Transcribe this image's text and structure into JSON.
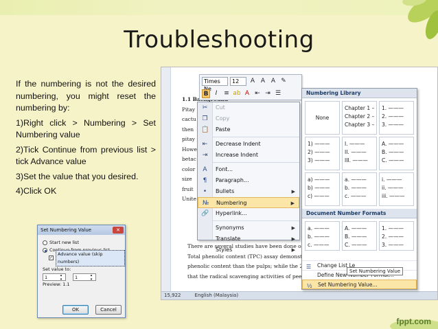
{
  "slide": {
    "title": "Troubleshooting",
    "brand": "fppt.com",
    "paragraphs": [
      "If the numbering is not the desired numbering, you might reset the numbering by:",
      "1)Right click > Numbering > Set Numbering value",
      "2)Tick Continue from previous list > tick Advance value",
      "3)Set the value that you desired.",
      "4)Click OK"
    ]
  },
  "word": {
    "doc_lines": [
      "1.1   Background",
      "Pitay",
      "cactu",
      "then",
      "pitay",
      "Howe",
      "betac",
      "color",
      "size",
      "fruit",
      "Unite"
    ],
    "doc_tail": [
      "There are several studies have been done on the rad",
      "Total phenolic content (TPC) assay demonstrated the",
      "phenolic content than the pulps; while the 2,2, dipher",
      "that the radical scavenging activities of peels are higher"
    ],
    "status": {
      "words": "15,922",
      "language": "English (Malaysia)"
    },
    "mini_toolbar": {
      "font": "Times Ne",
      "size": "12"
    },
    "context_menu": [
      {
        "label": "Cut",
        "icon": "cut-icon",
        "dim": true
      },
      {
        "label": "Copy",
        "icon": "copy-icon",
        "dim": true
      },
      {
        "label": "Paste",
        "icon": "paste-icon"
      },
      {
        "sep": true
      },
      {
        "label": "Decrease Indent",
        "icon": "decrease-indent-icon"
      },
      {
        "label": "Increase Indent",
        "icon": "increase-indent-icon"
      },
      {
        "sep": true
      },
      {
        "label": "Font...",
        "icon": "font-icon"
      },
      {
        "label": "Paragraph...",
        "icon": "paragraph-icon"
      },
      {
        "label": "Bullets",
        "icon": "bullets-icon",
        "sub": true
      },
      {
        "label": "Numbering",
        "icon": "numbering-icon",
        "sub": true,
        "hl": true
      },
      {
        "label": "Hyperlink...",
        "icon": "hyperlink-icon"
      },
      {
        "sep": true
      },
      {
        "label": "Synonyms",
        "sub": true
      },
      {
        "label": "Translate",
        "sub": true
      },
      {
        "label": "Styles",
        "sub": true
      }
    ],
    "numbering_library": {
      "header": "Numbering Library",
      "cells": [
        [
          "None"
        ],
        [
          "Chapter 1 –",
          "Chapter 2 –",
          "Chapter 3 –"
        ],
        [
          "1. ———",
          "2. ———",
          "3. ———"
        ],
        [
          "1) ———",
          "2) ———",
          "3) ———"
        ],
        [
          "I. ———",
          "II. ———",
          "III. ———"
        ],
        [
          "A. ———",
          "B. ———",
          "C. ———"
        ],
        [
          "a) ———",
          "b) ———",
          "c) ———"
        ],
        [
          "a. ———",
          "b. ———",
          "c. ———"
        ],
        [
          "i. ———",
          "ii. ———",
          "iii. ———"
        ]
      ],
      "doc_header": "Document Number Formats",
      "doc_cells": [
        [
          "a. ———",
          "b. ———",
          "c. ———"
        ],
        [
          "A. ———",
          "B. ———",
          "C. ———"
        ],
        [
          "1. ———",
          "2. ———",
          "3. ———"
        ]
      ],
      "footer": [
        "Change List Le",
        "Define New Number Format...",
        "Set Numbering Value..."
      ],
      "tooltip": "Set Numbering Value"
    }
  },
  "dialog": {
    "title": "Set Numbering Value",
    "start_new": "Start new list",
    "continue": "Continue from previous list",
    "advance": "Advance value (skip numbers)",
    "set_value_to": "Set value to:",
    "value_a": "1",
    "value_b": "1",
    "preview": "Preview: 1.1",
    "ok": "OK",
    "cancel": "Cancel"
  }
}
